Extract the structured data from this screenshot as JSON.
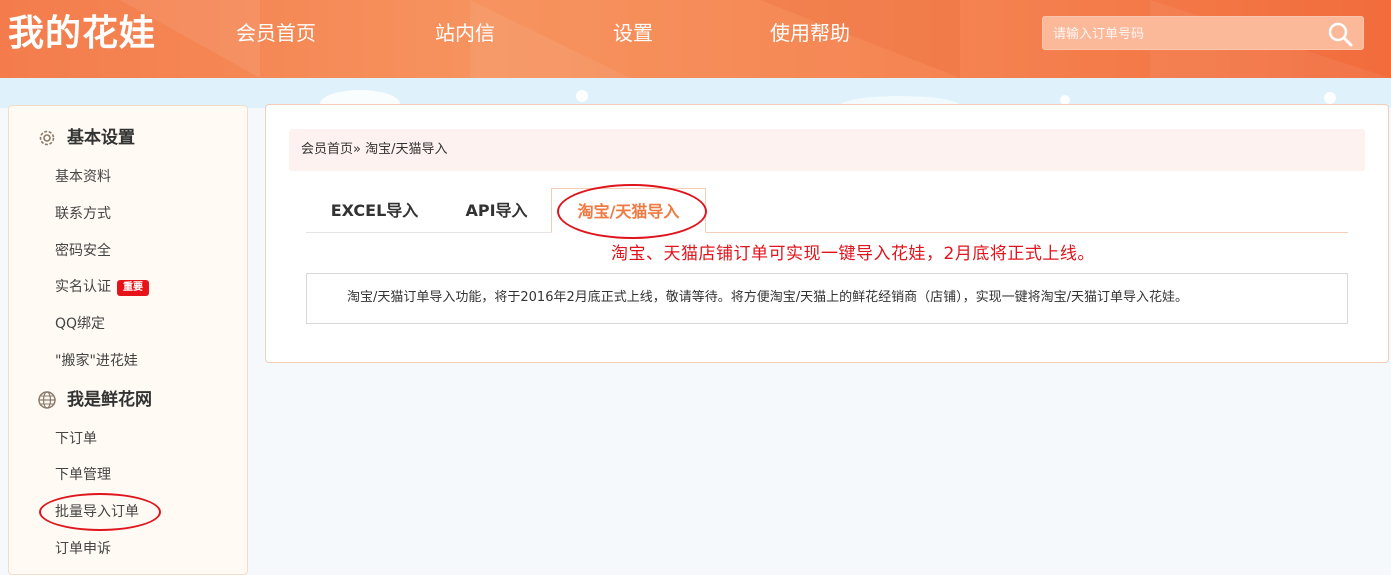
{
  "header": {
    "logo": "我的花娃",
    "nav": [
      "会员首页",
      "站内信",
      "设置",
      "使用帮助"
    ],
    "search_placeholder": "请输入订单号码",
    "search_icon": "search-icon"
  },
  "sidebar": {
    "sections": [
      {
        "title": "基本设置",
        "icon": "gear-icon",
        "items": [
          "基本资料",
          "联系方式",
          "密码安全",
          "实名认证",
          "QQ绑定",
          "\"搬家\"进花娃"
        ]
      },
      {
        "title": "我是鲜花网",
        "icon": "globe-icon",
        "items": [
          "下订单",
          "下单管理",
          "批量导入订单",
          "订单申诉"
        ]
      }
    ],
    "badge": "重要"
  },
  "main": {
    "breadcrumb": "会员首页» 淘宝/天猫导入",
    "tabs": [
      "EXCEL导入",
      "API导入",
      "淘宝/天猫导入"
    ],
    "active_tab": "淘宝/天猫导入",
    "notice": "淘宝、天猫店铺订单可实现一键导入花娃，2月底将正式上线。",
    "description": "淘宝/天猫订单导入功能，将于2016年2月底正式上线，敬请等待。将方便淘宝/天猫上的鲜花经销商（店铺），实现一键将淘宝/天猫订单导入花娃。"
  },
  "colors": {
    "header_orange": "#f47c4c",
    "accent": "#f07a43",
    "red": "#e0141c"
  }
}
